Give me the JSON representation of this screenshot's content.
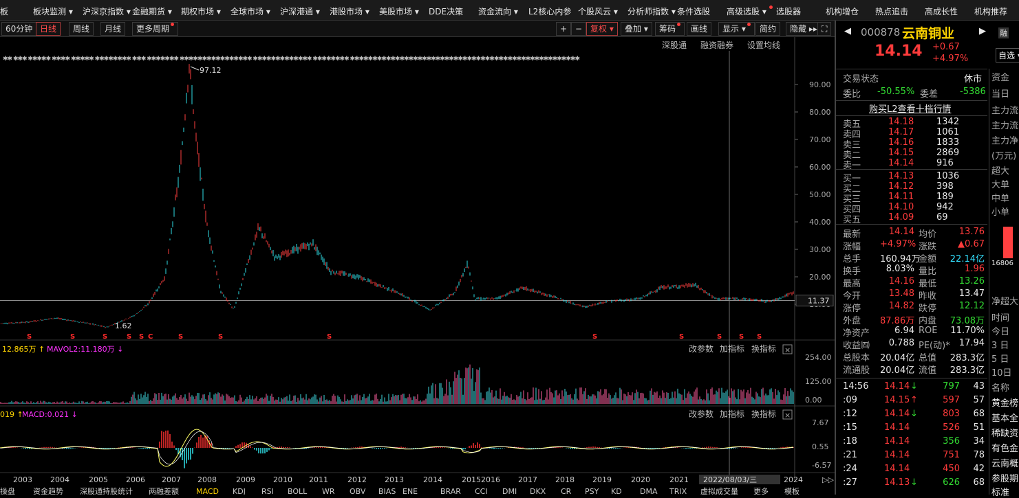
{
  "topmenu": [
    "板",
    "板块监测",
    "沪深京指数",
    "金融期货",
    "期权市场",
    "全球市场",
    "沪深港通",
    "港股市场",
    "美股市场",
    "DDE决策",
    "资金流向",
    "L2核心内参",
    "个股风云",
    "分析师指数",
    "条件选股",
    "高级选股",
    "选股器",
    "机构增仓",
    "热点追击",
    "高成长性",
    "机构推荐"
  ],
  "periods": [
    "60分钟",
    "日线",
    "周线",
    "月线",
    "更多周期"
  ],
  "tools": [
    "复权",
    "叠加",
    "筹码",
    "画线",
    "显示",
    "简约",
    "隐藏"
  ],
  "chart_links": [
    "深股通",
    "融资融券",
    "设置均线"
  ],
  "price_high_label": "97.12",
  "price_low_label": "1.62",
  "price_ticks": [
    "90.00",
    "80.00",
    "70.00",
    "60.00",
    "50.00",
    "40.00",
    "30.00",
    "20.00",
    "10.00"
  ],
  "current_price_tag": "11.37",
  "vol_header": "12.865万",
  "vol_ma_label": "MAVOL2:11.180万",
  "vol_ticks": [
    "254.00",
    "125.00",
    "0.00"
  ],
  "macd_header": "019",
  "macd_label": "MACD:0.021",
  "macd_ticks": [
    "7.67",
    "0.55",
    "-6.57"
  ],
  "panel_links": [
    "改参数",
    "加指标",
    "换指标"
  ],
  "years": [
    "2003",
    "2004",
    "2005",
    "2006",
    "2007",
    "2008",
    "2009",
    "2010",
    "2011",
    "2012",
    "2013",
    "2014",
    "2015",
    "2016",
    "2017",
    "2018",
    "2019",
    "2020",
    "2021",
    "202",
    "2024"
  ],
  "cursor_date": "2022/08/03/三",
  "bottom_tabs": [
    "操盘",
    "资金趋势",
    "深股通持股统计",
    "两融差额",
    "MACD",
    "KDJ",
    "RSI",
    "BOLL",
    "WR",
    "OBV",
    "BIAS",
    "ENE",
    "BRAR",
    "CCI",
    "DMI",
    "DKX",
    "CR",
    "PSY",
    "KD",
    "DMA",
    "TRIX",
    "虚拟成交量",
    "更多",
    "模板"
  ],
  "stock": {
    "code": "000878",
    "name": "云南铜业",
    "price": "14.14",
    "change": "+0.67",
    "pct": "+4.97%",
    "watch": "自选"
  },
  "status": {
    "label": "交易状态",
    "value": "休市"
  },
  "ratio": {
    "label": "委比",
    "value": "-50.55%",
    "diff_label": "委差",
    "diff": "-5386"
  },
  "l2_link": "购买L2查看十档行情",
  "asks": [
    {
      "l": "卖五",
      "p": "14.18",
      "v": "1342"
    },
    {
      "l": "卖四",
      "p": "14.17",
      "v": "1061"
    },
    {
      "l": "卖三",
      "p": "14.16",
      "v": "1833"
    },
    {
      "l": "卖二",
      "p": "14.15",
      "v": "2869"
    },
    {
      "l": "卖一",
      "p": "14.14",
      "v": "916"
    }
  ],
  "bids": [
    {
      "l": "买一",
      "p": "14.13",
      "v": "1036"
    },
    {
      "l": "买二",
      "p": "14.12",
      "v": "398"
    },
    {
      "l": "买三",
      "p": "14.11",
      "v": "189"
    },
    {
      "l": "买四",
      "p": "14.10",
      "v": "942"
    },
    {
      "l": "买五",
      "p": "14.09",
      "v": "69"
    }
  ],
  "stats": [
    [
      "最新",
      "14.14",
      "red",
      "均价",
      "13.76",
      "red"
    ],
    [
      "涨幅",
      "+4.97%",
      "red",
      "涨跌",
      "▲0.67",
      "red"
    ],
    [
      "总手",
      "160.94万",
      "white",
      "金额",
      "22.14亿",
      "cyan"
    ],
    [
      "换手",
      "8.03%",
      "white",
      "量比",
      "1.96",
      "red"
    ],
    [
      "最高",
      "14.16",
      "red",
      "最低",
      "13.26",
      "green"
    ],
    [
      "今开",
      "13.48",
      "red",
      "昨收",
      "13.47",
      "white"
    ],
    [
      "涨停",
      "14.82",
      "red",
      "跌停",
      "12.12",
      "green"
    ],
    [
      "外盘",
      "87.86万",
      "red",
      "内盘",
      "73.08万",
      "green"
    ],
    [
      "净资产",
      "6.94",
      "white",
      "ROE",
      "11.70%",
      "white"
    ],
    [
      "收益㈣",
      "0.788",
      "white",
      "PE(动)*",
      "17.94",
      "white"
    ],
    [
      "总股本",
      "20.04亿",
      "white",
      "总值",
      "283.3亿",
      "white"
    ],
    [
      "流通股",
      "20.04亿",
      "white",
      "流值",
      "283.3亿",
      "white"
    ]
  ],
  "ticks": [
    {
      "t": "14:56",
      "p": "14.14",
      "a": "↓",
      "ac": "green",
      "v": "797",
      "vc": "green",
      "n": "43"
    },
    {
      "t": ":09",
      "p": "14.15",
      "a": "↑",
      "ac": "red",
      "v": "597",
      "vc": "red",
      "n": "57"
    },
    {
      "t": ":12",
      "p": "14.14",
      "a": "↓",
      "ac": "green",
      "v": "803",
      "vc": "red",
      "n": "68"
    },
    {
      "t": ":15",
      "p": "14.14",
      "a": "",
      "ac": "",
      "v": "526",
      "vc": "red",
      "n": "51"
    },
    {
      "t": ":18",
      "p": "14.14",
      "a": "",
      "ac": "",
      "v": "356",
      "vc": "green",
      "n": "34"
    },
    {
      "t": ":21",
      "p": "14.14",
      "a": "",
      "ac": "",
      "v": "751",
      "vc": "red",
      "n": "78"
    },
    {
      "t": ":24",
      "p": "14.14",
      "a": "",
      "ac": "",
      "v": "450",
      "vc": "red",
      "n": "42"
    },
    {
      "t": ":27",
      "p": "14.13",
      "a": "↓",
      "ac": "green",
      "v": "626",
      "vc": "green",
      "n": "68"
    }
  ],
  "side_col": [
    "资金",
    "当日",
    "主力流",
    "主力流",
    "主力净",
    "(万元)",
    "超大",
    "大单",
    "中单",
    "小单",
    "16806",
    "净超大",
    "时间",
    "今日",
    "3 日",
    "5 日",
    "10日",
    "名称",
    "黄金榜",
    "基本全",
    "稀缺资",
    "有色金",
    "云南概",
    "参股期",
    "标准"
  ],
  "chart_data": {
    "type": "candlestick",
    "x_range": [
      "2003",
      "2024"
    ],
    "ylim": [
      0,
      100
    ],
    "series_summary": {
      "all_time_high": 97.12,
      "all_time_low": 1.62,
      "last": 14.14
    }
  }
}
